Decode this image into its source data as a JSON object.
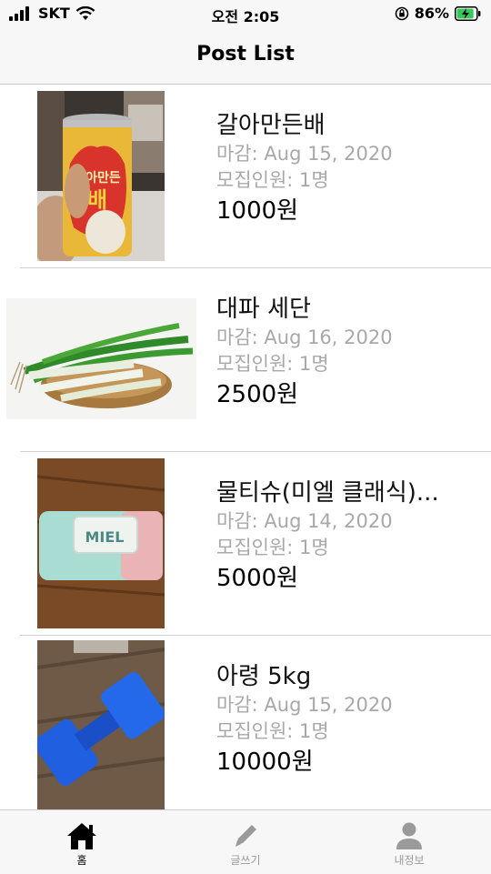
{
  "status_bar": {
    "carrier": "SKT",
    "time": "오전 2:05",
    "battery": "86%"
  },
  "nav": {
    "title": "Post List"
  },
  "posts": [
    {
      "title": "갈아만든배",
      "deadline": "마감: Aug 15, 2020",
      "recruit": "모집인원: 1명",
      "price": "1000원",
      "image": "pear-juice-can-photo"
    },
    {
      "title": "대파 세단",
      "deadline": "마감: Aug 16, 2020",
      "recruit": "모집인원: 1명",
      "price": "2500원",
      "image": "green-onion-photo"
    },
    {
      "title": "물티슈(미엘 클래식)...",
      "deadline": "마감: Aug 14, 2020",
      "recruit": "모집인원: 1명",
      "price": "5000원",
      "image": "wet-wipes-photo"
    },
    {
      "title": "아령 5kg",
      "deadline": "마감: Aug 15, 2020",
      "recruit": "모집인원: 1명",
      "price": "10000원",
      "image": "dumbbell-photo"
    }
  ],
  "tabs": [
    {
      "label": "홈",
      "icon": "home-icon",
      "active": true
    },
    {
      "label": "글쓰기",
      "icon": "pencil-icon",
      "active": false
    },
    {
      "label": "내정보",
      "icon": "person-icon",
      "active": false
    }
  ],
  "colors": {
    "bar_background": "#f7f7f7",
    "meta_text": "#a8a8a8",
    "inactive_tab": "#9a9a9a",
    "battery_fill": "#34c759"
  }
}
